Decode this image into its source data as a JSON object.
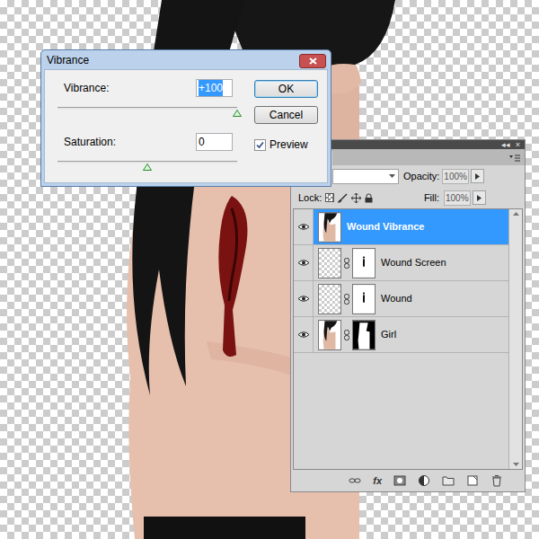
{
  "dialog": {
    "title": "Vibrance",
    "adjustments": [
      {
        "label": "Vibrance:",
        "value": "+100",
        "value_selected": true,
        "level": 1
      },
      {
        "label": "Saturation:",
        "value": "0",
        "value_selected": false,
        "level": 0.5
      }
    ],
    "buttons": [
      {
        "label": "OK",
        "default": true
      },
      {
        "label": "Cancel",
        "default": false
      }
    ],
    "preview": {
      "label": "Preview",
      "checked": true
    }
  },
  "layers_panel": {
    "header_buttons": [
      "◂◂",
      "×"
    ],
    "opacity_label": "Opacity:",
    "opacity": "100%",
    "lock_label": "Lock:",
    "fill_label": "Fill:",
    "fill": "100%",
    "layers": [
      {
        "name": "Wound Vibrance",
        "selected": true,
        "visible": true,
        "kind": "photo",
        "mask": false
      },
      {
        "name": "Wound Screen",
        "selected": false,
        "visible": true,
        "kind": "transparent",
        "mask": true
      },
      {
        "name": "Wound",
        "selected": false,
        "visible": true,
        "kind": "transparent",
        "mask": true
      },
      {
        "name": "Girl",
        "selected": false,
        "visible": true,
        "kind": "photo",
        "mask": true
      }
    ],
    "footer_fx": "fx"
  }
}
